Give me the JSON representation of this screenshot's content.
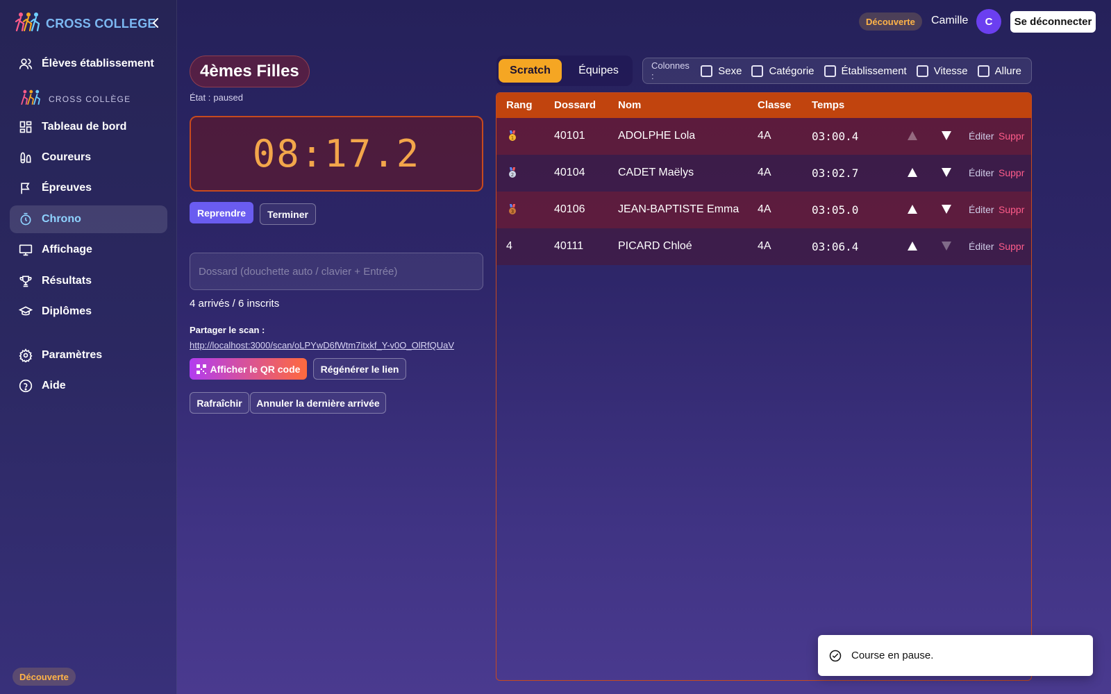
{
  "brand": {
    "title": "CROSS COLLEGE"
  },
  "sidebar": {
    "top_item": {
      "label": "Élèves établissement",
      "icon": "users-icon"
    },
    "section_label": "CROSS COLLÈGE",
    "items": [
      {
        "label": "Tableau de bord",
        "icon": "dashboard-icon"
      },
      {
        "label": "Coureurs",
        "icon": "footprints-icon"
      },
      {
        "label": "Épreuves",
        "icon": "flag-icon"
      },
      {
        "label": "Chrono",
        "icon": "timer-icon",
        "active": true
      },
      {
        "label": "Affichage",
        "icon": "monitor-icon"
      },
      {
        "label": "Résultats",
        "icon": "trophy-icon"
      },
      {
        "label": "Diplômes",
        "icon": "graduation-cap-icon"
      }
    ],
    "bottom_items": [
      {
        "label": "Paramètres",
        "icon": "gear-icon"
      },
      {
        "label": "Aide",
        "icon": "help-icon"
      }
    ],
    "plan_badge": "Découverte"
  },
  "topbar": {
    "plan_badge": "Découverte",
    "username": "Camille",
    "avatar_initial": "C",
    "logout_label": "Se déconnecter"
  },
  "race": {
    "title": "4èmes Filles",
    "state_label": "État :",
    "state_value": "paused",
    "chrono": "08:17.2",
    "resume_label": "Reprendre",
    "finish_label": "Terminer",
    "bib_placeholder": "Dossard (douchette auto / clavier + Entrée)",
    "arrivals_text": "4 arrivés / 6 inscrits",
    "share_label": "Partager le scan :",
    "share_url": "http://localhost:3000/scan/oLPYwD6fWtm7itxkf_Y-v0O_OlRfQUaV",
    "qr_label": "Afficher le QR code",
    "regen_label": "Régénérer le lien",
    "refresh_label": "Rafraîchir",
    "undo_label": "Annuler la dernière arrivée"
  },
  "tabs": {
    "scratch": "Scratch",
    "teams": "Équipes",
    "active": "Scratch"
  },
  "columns": {
    "label": "Colonnes :",
    "options": [
      {
        "label": "Sexe",
        "checked": false
      },
      {
        "label": "Catégorie",
        "checked": false
      },
      {
        "label": "Établissement",
        "checked": false
      },
      {
        "label": "Vitesse",
        "checked": false
      },
      {
        "label": "Allure",
        "checked": false
      }
    ]
  },
  "table": {
    "headers": {
      "rank": "Rang",
      "bib": "Dossard",
      "name": "Nom",
      "class": "Classe",
      "time": "Temps"
    },
    "edit_label": "Éditer",
    "delete_label": "Suppr",
    "rows": [
      {
        "rank": "1",
        "medal": "gold-medal-icon",
        "bib": "40101",
        "name": "ADOLPHE Lola",
        "class": "4A",
        "time": "03:00.4",
        "up_enabled": false,
        "down_enabled": true
      },
      {
        "rank": "2",
        "medal": "silver-medal-icon",
        "bib": "40104",
        "name": "CADET Maëlys",
        "class": "4A",
        "time": "03:02.7",
        "up_enabled": true,
        "down_enabled": true
      },
      {
        "rank": "3",
        "medal": "bronze-medal-icon",
        "bib": "40106",
        "name": "JEAN-BAPTISTE Emma",
        "class": "4A",
        "time": "03:05.0",
        "up_enabled": true,
        "down_enabled": true
      },
      {
        "rank": "4",
        "medal": null,
        "bib": "40111",
        "name": "PICARD Chloé",
        "class": "4A",
        "time": "03:06.4",
        "up_enabled": true,
        "down_enabled": false
      }
    ]
  },
  "toast": {
    "message": "Course en pause."
  },
  "colors": {
    "accent": "#f5a623",
    "primary": "#6a5cf0",
    "header_orange": "#c1440e",
    "chrono_text": "#f3a64b",
    "delete_pink": "#ff5c8a",
    "brand_blue": "#7cb8f2"
  }
}
